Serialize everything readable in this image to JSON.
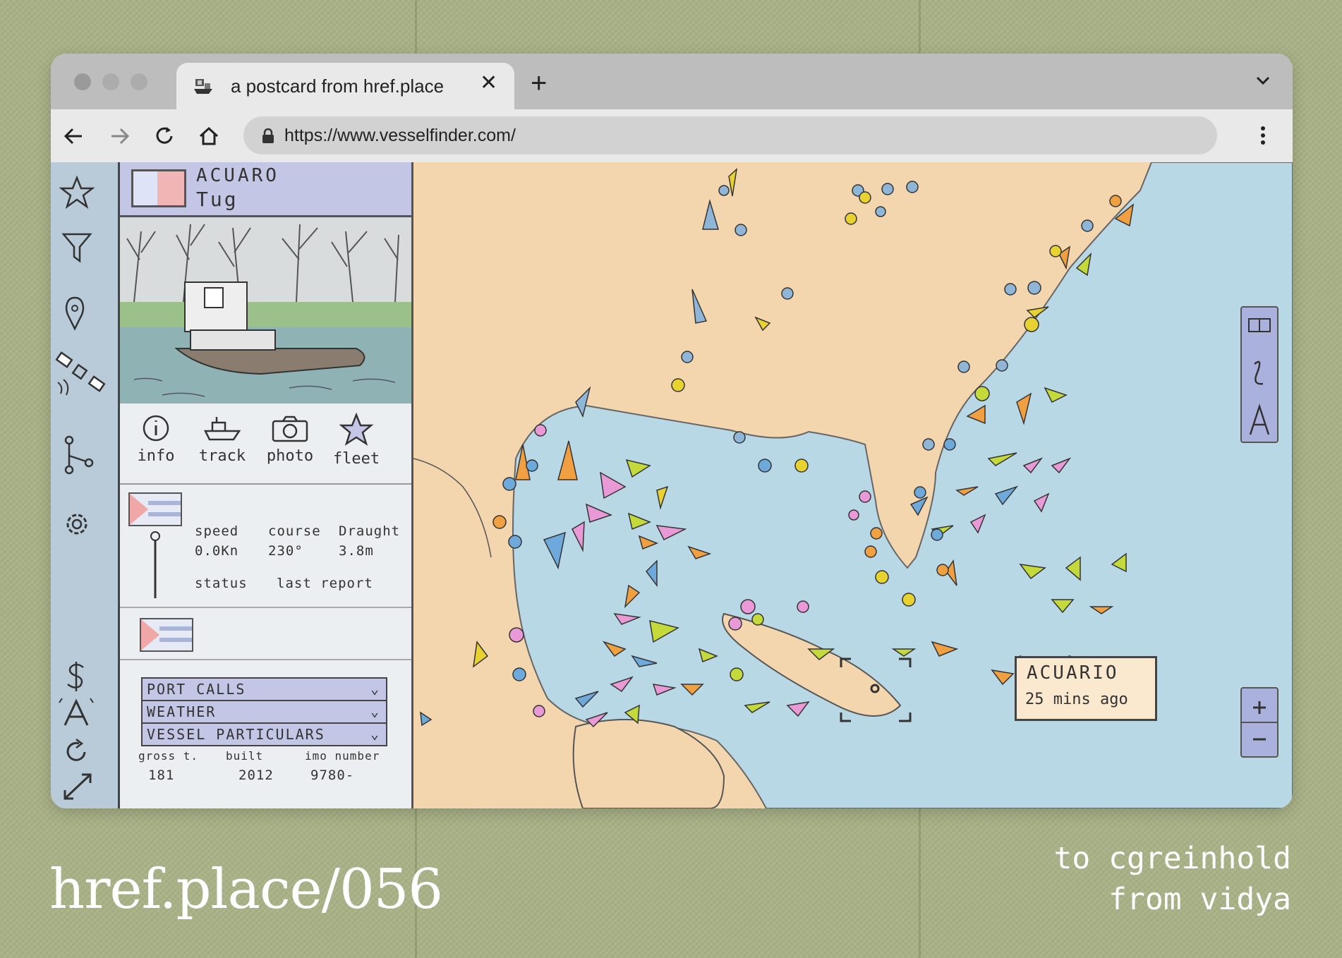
{
  "browser": {
    "tab_title": "a postcard from href.place",
    "url": "https://www.vesselfinder.com/"
  },
  "vessel_panel": {
    "name": "ACUARO",
    "type": "Tug",
    "actions": [
      "info",
      "track",
      "photo",
      "fleet"
    ],
    "stats_headers": [
      "speed",
      "course",
      "Draught"
    ],
    "stats_values": [
      "0.0Kn",
      "230°",
      "3.8m"
    ],
    "status_headers": [
      "status",
      "last report"
    ],
    "accordions": [
      "PORT CALLS",
      "WEATHER",
      "VESSEL PARTICULARS"
    ],
    "particulars_headers": [
      "gross t.",
      "built",
      "imo number"
    ],
    "particulars_values": [
      "181",
      "2012",
      "9780-"
    ]
  },
  "map_popup": {
    "vessel_name": "ACUARIO",
    "last_seen": "25 mins ago"
  },
  "caption": {
    "left": "href.place/056",
    "right_line1": "to cgreinhold",
    "right_line2": "from vidya"
  },
  "colors": {
    "water": "#b9d8e6",
    "land": "#f3d6ae",
    "panel_header": "#c3c6e4",
    "postcard_bg": "#a9b187"
  }
}
